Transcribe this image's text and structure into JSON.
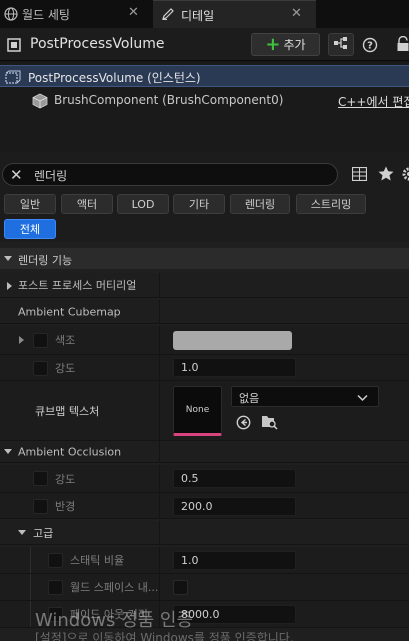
{
  "tabs": [
    {
      "label": "월드 세팅"
    },
    {
      "label": "디테일"
    }
  ],
  "header": {
    "title": "PostProcessVolume",
    "add_label": "추가"
  },
  "tree": {
    "root_label": "PostProcessVolume (인스턴스)",
    "child_label": "BrushComponent (BrushComponent0)",
    "edit_link": "C++에서 편집"
  },
  "search": {
    "value": "렌더링"
  },
  "filters": [
    "일반",
    "액터",
    "LOD",
    "기타",
    "렌더링",
    "스트리밍",
    "전체"
  ],
  "details": {
    "section_rendering": "렌더링 기능",
    "post_process_material": "포스트 프로세스 머티리얼",
    "ambient_cubemap": {
      "header": "Ambient Cubemap",
      "tint_label": "색조",
      "intensity_label": "강도",
      "intensity_value": "1.0",
      "cubemap_texture_label": "큐브맵 텍스처",
      "thumbnail_label": "None",
      "asset_value": "없음"
    },
    "ambient_occlusion": {
      "header": "Ambient Occlusion",
      "intensity_label": "강도",
      "intensity_value": "0.5",
      "radius_label": "반경",
      "radius_value": "200.0",
      "advanced_label": "고급",
      "static_fraction_label": "스태틱 비율",
      "static_fraction_value": "1.0",
      "world_space_label": "월드 스페이스 내...",
      "fade_out_label": "페이드 아웃 거리",
      "fade_out_value": "8000.0"
    }
  },
  "watermark": {
    "line1": "Windows 정품 인증",
    "line2": "[설정]으로 이동하여 Windows를 정품 인증합니다."
  },
  "colors": {
    "accent": "#1f6fe0",
    "selected_row": "#2a3a55",
    "add_plus": "#3fbf3f",
    "thumbnail_underline": "#d8457e"
  }
}
